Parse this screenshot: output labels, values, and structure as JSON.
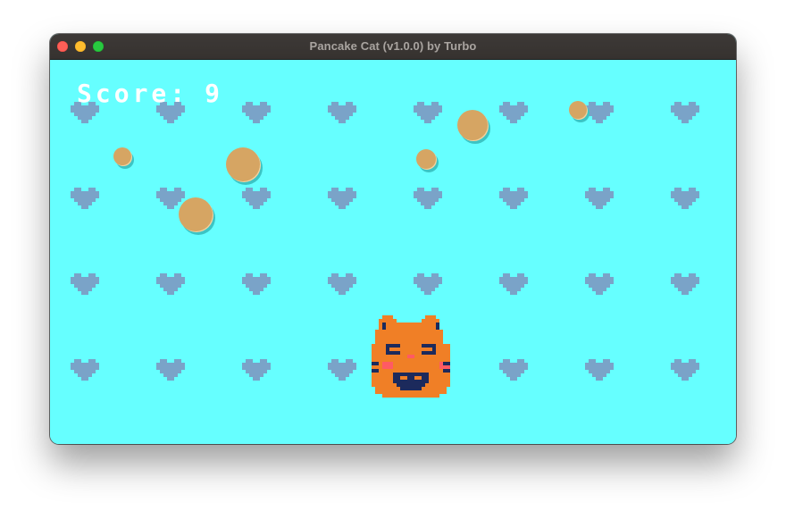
{
  "window": {
    "title": "Pancake Cat (v1.0.0) by Turbo"
  },
  "hud": {
    "score_label": "Score:",
    "score_value": "9"
  },
  "colors": {
    "background": "#66ffff",
    "heart": "#7aa3c8",
    "pancake": "#d6a563",
    "pancake_shadow": "#3cc4c4",
    "pancake_highlight": "#f2d3a0",
    "cat_orange": "#f07f26",
    "cat_dark": "#1c2a5c",
    "cat_blush": "#ff5a63",
    "titlebar": "#3a3634"
  },
  "icons": {
    "background_pattern": "heart-icon",
    "falling_item": "pancake-icon",
    "player": "cat-face-icon"
  }
}
